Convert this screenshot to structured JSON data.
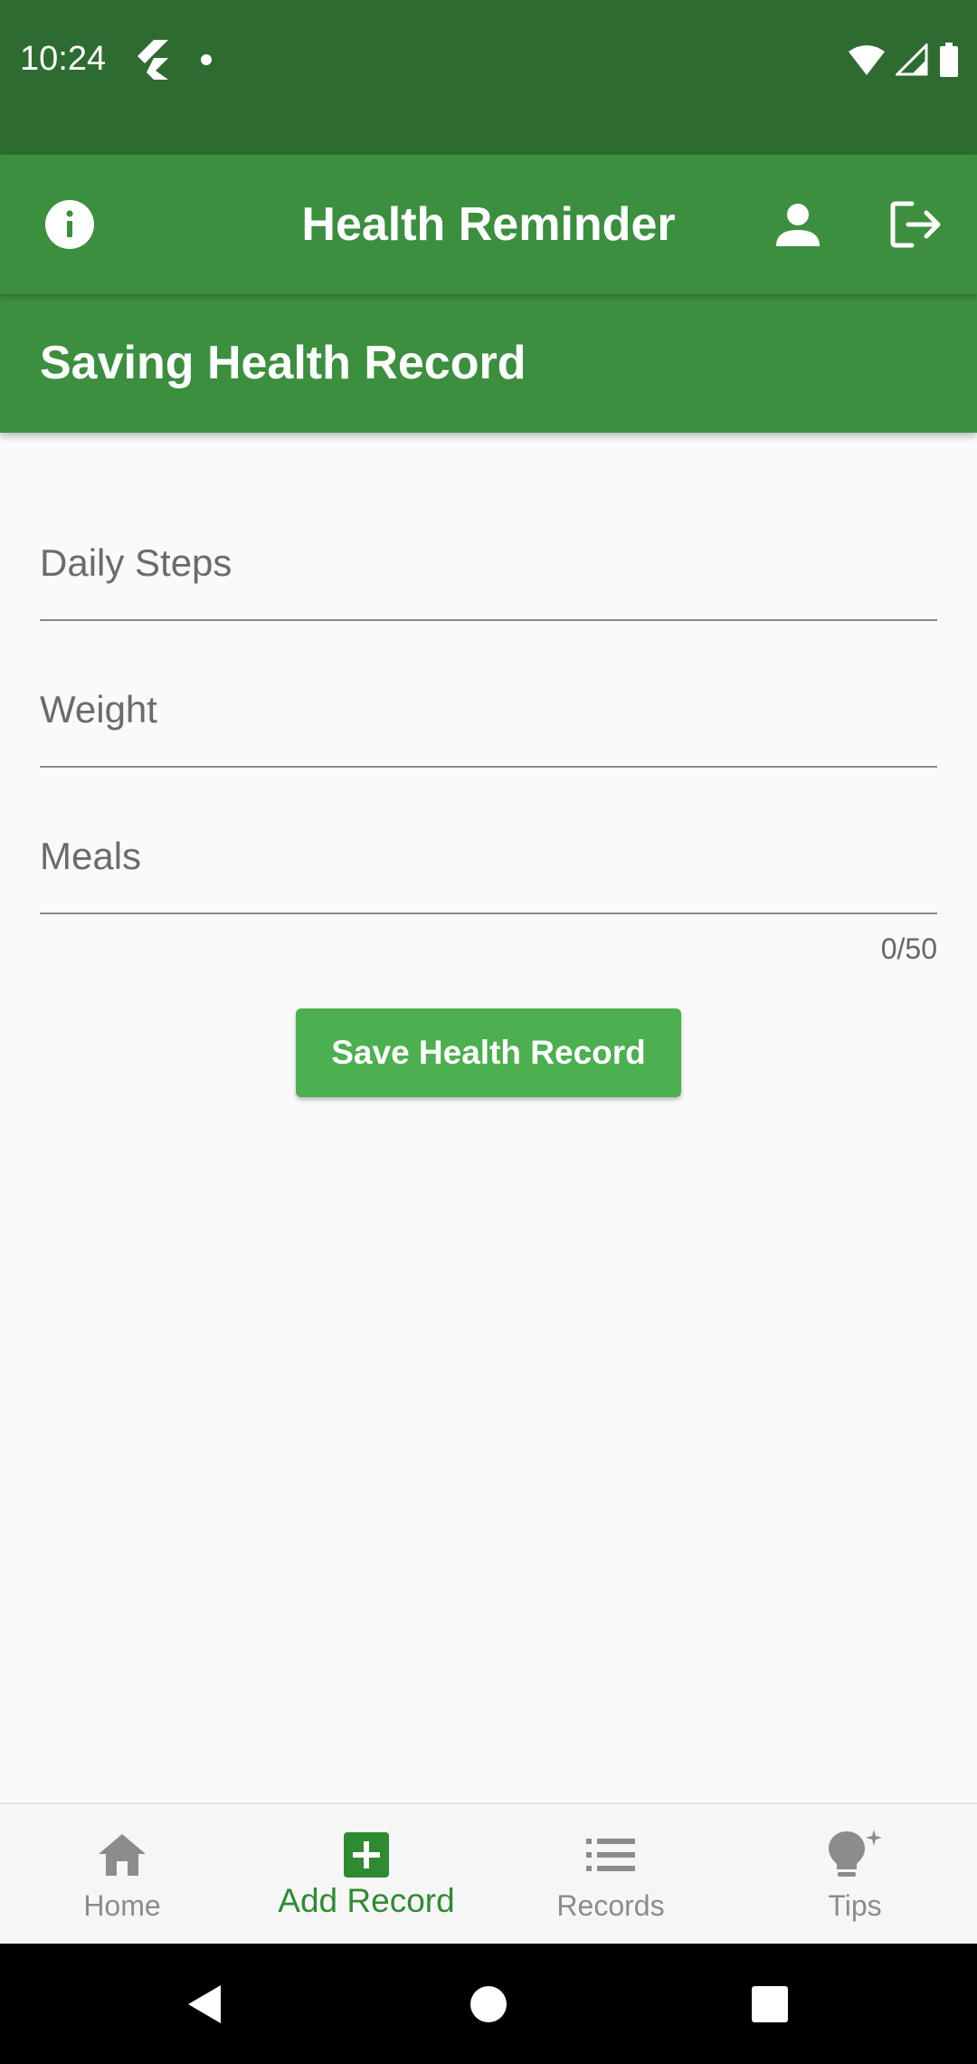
{
  "status_bar": {
    "time": "10:24"
  },
  "app_bar": {
    "title": "Health Reminder",
    "left_icon": "info-icon",
    "right_icons": [
      "person-icon",
      "logout-icon"
    ]
  },
  "section": {
    "title": "Saving Health Record"
  },
  "form": {
    "daily_steps_placeholder": "Daily Steps",
    "daily_steps_value": "",
    "weight_placeholder": "Weight",
    "weight_value": "",
    "meals_placeholder": "Meals",
    "meals_value": "",
    "meals_counter": "0/50",
    "save_label": "Save Health Record"
  },
  "bottom_nav": {
    "items": [
      {
        "label": "Home",
        "icon": "home-icon",
        "active": false
      },
      {
        "label": "Add Record",
        "icon": "add-box-icon",
        "active": true
      },
      {
        "label": "Records",
        "icon": "list-icon",
        "active": false
      },
      {
        "label": "Tips",
        "icon": "lightbulb-icon",
        "active": false
      }
    ]
  },
  "colors": {
    "status_bar": "#2e6b30",
    "app_bar": "#3b8f3e",
    "button": "#4caf50",
    "active_nav": "#2e8b32",
    "inactive_nav": "#8c8c8c",
    "background": "#fafafa"
  }
}
